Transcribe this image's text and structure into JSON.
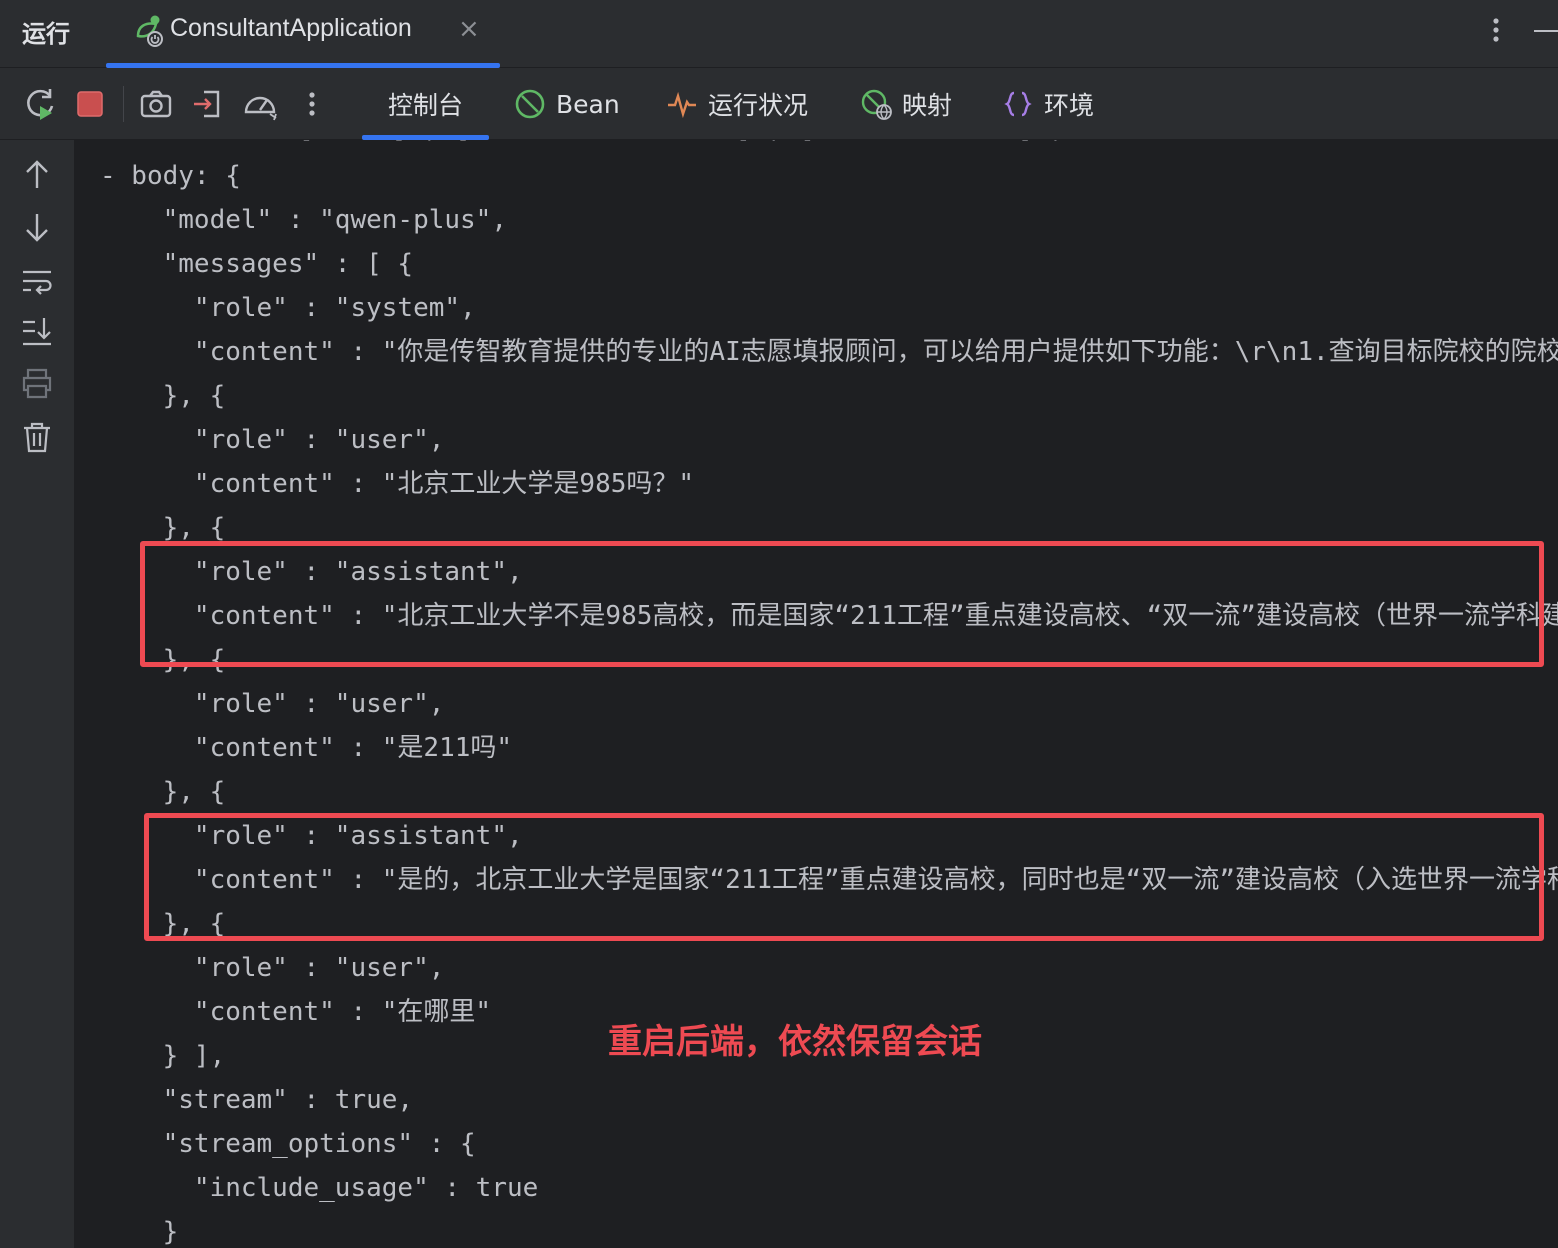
{
  "titlebar": {
    "run_label": "运行",
    "app_tab_label": "ConsultantApplication",
    "close_symbol": "×"
  },
  "toolbar": {
    "tabs": [
      {
        "label": "控制台",
        "icon": "none",
        "active": true
      },
      {
        "label": "Bean",
        "icon": "bean-icon",
        "active": false
      },
      {
        "label": "运行状况",
        "icon": "pulse-icon",
        "active": false
      },
      {
        "label": "映射",
        "icon": "globe-icon",
        "active": false
      },
      {
        "label": "环境",
        "icon": "braces-icon",
        "active": false
      }
    ]
  },
  "colors": {
    "background": "#1e1f22",
    "panel": "#2b2d30",
    "accent": "#3574f0",
    "highlight_red": "#ee4a52",
    "text": "#bcbec4"
  },
  "console": {
    "cut_top": "- ... [ ... ] , [ ... ... ... ... ] , [ ... ... ... ] , ... ...",
    "lines": [
      "- body: {",
      "    \"model\" : \"qwen-plus\",",
      "    \"messages\" : [ {",
      "      \"role\" : \"system\",",
      "      \"content\" : \"你是传智教育提供的专业的AI志愿填报顾问，可以给用户提供如下功能：\\r\\n1.查询目标院校的院校简介",
      "    }, {",
      "      \"role\" : \"user\",",
      "      \"content\" : \"北京工业大学是985吗？\"",
      "    }, {",
      "      \"role\" : \"assistant\",",
      "      \"content\" : \"北京工业大学不是985高校，而是国家“211工程”重点建设高校、“双一流”建设高校（世界一流学科建设",
      "    }, {",
      "      \"role\" : \"user\",",
      "      \"content\" : \"是211吗\"",
      "    }, {",
      "      \"role\" : \"assistant\",",
      "      \"content\" : \"是的，北京工业大学是国家“211工程”重点建设高校，同时也是“双一流”建设高校（入选世界一流学科建设",
      "    }, {",
      "      \"role\" : \"user\",",
      "      \"content\" : \"在哪里\"",
      "    } ],",
      "    \"stream\" : true,",
      "    \"stream_options\" : {",
      "      \"include_usage\" : true",
      "    }"
    ],
    "annotation": "重启后端，依然保留会话"
  }
}
